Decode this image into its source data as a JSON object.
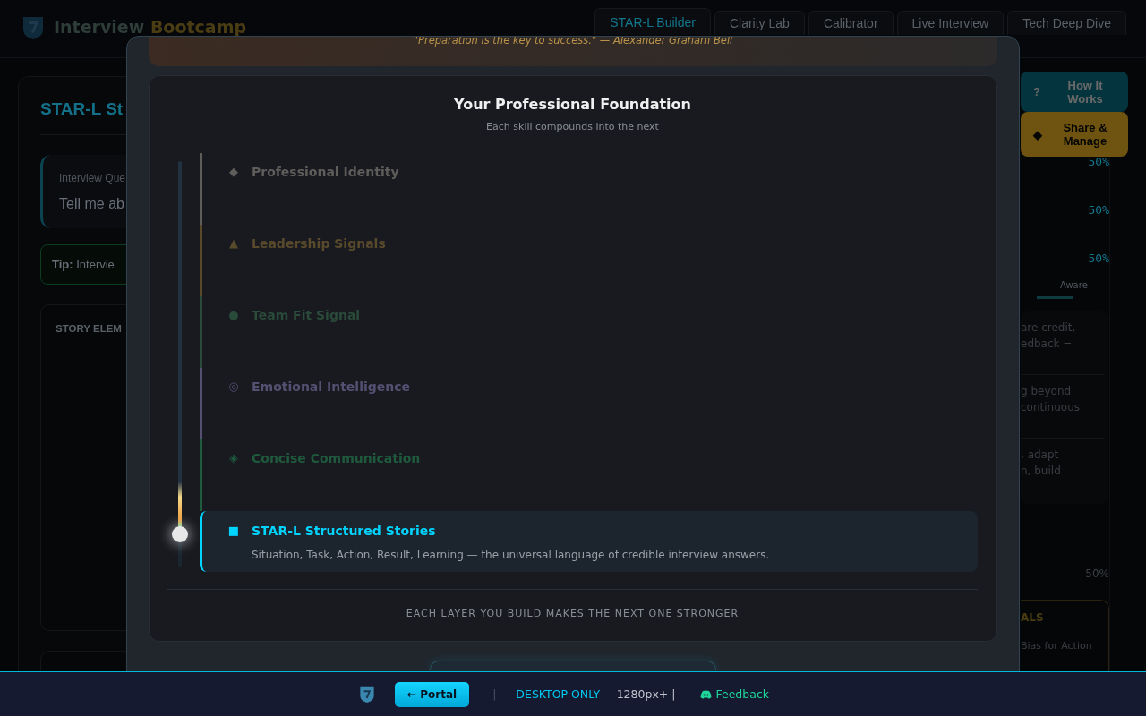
{
  "header": {
    "title": "Interview",
    "title_accent": "Bootcamp"
  },
  "tabs": [
    {
      "label": "STAR-L Builder",
      "selected": true
    },
    {
      "label": "Clarity Lab",
      "selected": false
    },
    {
      "label": "Calibrator",
      "selected": false
    },
    {
      "label": "Live Interview",
      "selected": false
    },
    {
      "label": "Tech Deep Dive",
      "selected": false
    }
  ],
  "story_panel": {
    "title": "STAR-L St",
    "question_label": "Interview Que",
    "question": "Tell me ab",
    "tip": "**Tip:** Intervie",
    "story_elements_heading": "STORY ELEM"
  },
  "floating_buttons": [
    {
      "kind": "help",
      "icon": "?",
      "label": "How It Works"
    },
    {
      "kind": "share",
      "icon": "◆",
      "label": "Share & Manage"
    }
  ],
  "insight_panel": {
    "scores": [
      "50%",
      "50%",
      "50%"
    ],
    "level_label": "Aware",
    "notes": [
      "are credit,\nedback =",
      "g beyond\ncontinuous",
      ", adapt\nn, build"
    ],
    "total": "50%",
    "goals_heading": "ALS",
    "goals": [
      "Bias for Action"
    ]
  },
  "modal": {
    "quote": "\"Preparation is the key to success.\" — Alexander Graham Bell",
    "title": "Your Professional Foundation",
    "subtitle": "Each skill compounds into the next",
    "progress": {
      "level": 0.92
    },
    "layers": [
      {
        "icon": "◆",
        "name": "Professional Identity",
        "color": "#5e5d5a",
        "active": false
      },
      {
        "icon": "▲",
        "name": "Leadership Signals",
        "color": "#5a4a2c",
        "active": false
      },
      {
        "icon": "●",
        "name": "Team Fit Signal",
        "color": "#2a4a3a",
        "active": false
      },
      {
        "icon": "◎",
        "name": "Emotional Intelligence",
        "color": "#554f72",
        "active": false
      },
      {
        "icon": "◈",
        "name": "Concise Communication",
        "color": "#1f5a3d",
        "active": false
      },
      {
        "icon": "■",
        "name": "STAR-L Structured Stories",
        "color": "#00d4ff",
        "active": true,
        "description": "Situation, Task, Action, Result, Learning — the universal language of credible interview answers."
      }
    ],
    "footer_note": "EACH LAYER YOU BUILD MAKES THE NEXT ONE STRONGER"
  },
  "footer": {
    "portal_button": "← Portal",
    "separator": "|",
    "desktop_label": "DESKTOP ONLY",
    "resolution": "- 1280px+ |",
    "feedback": "Feedback"
  }
}
